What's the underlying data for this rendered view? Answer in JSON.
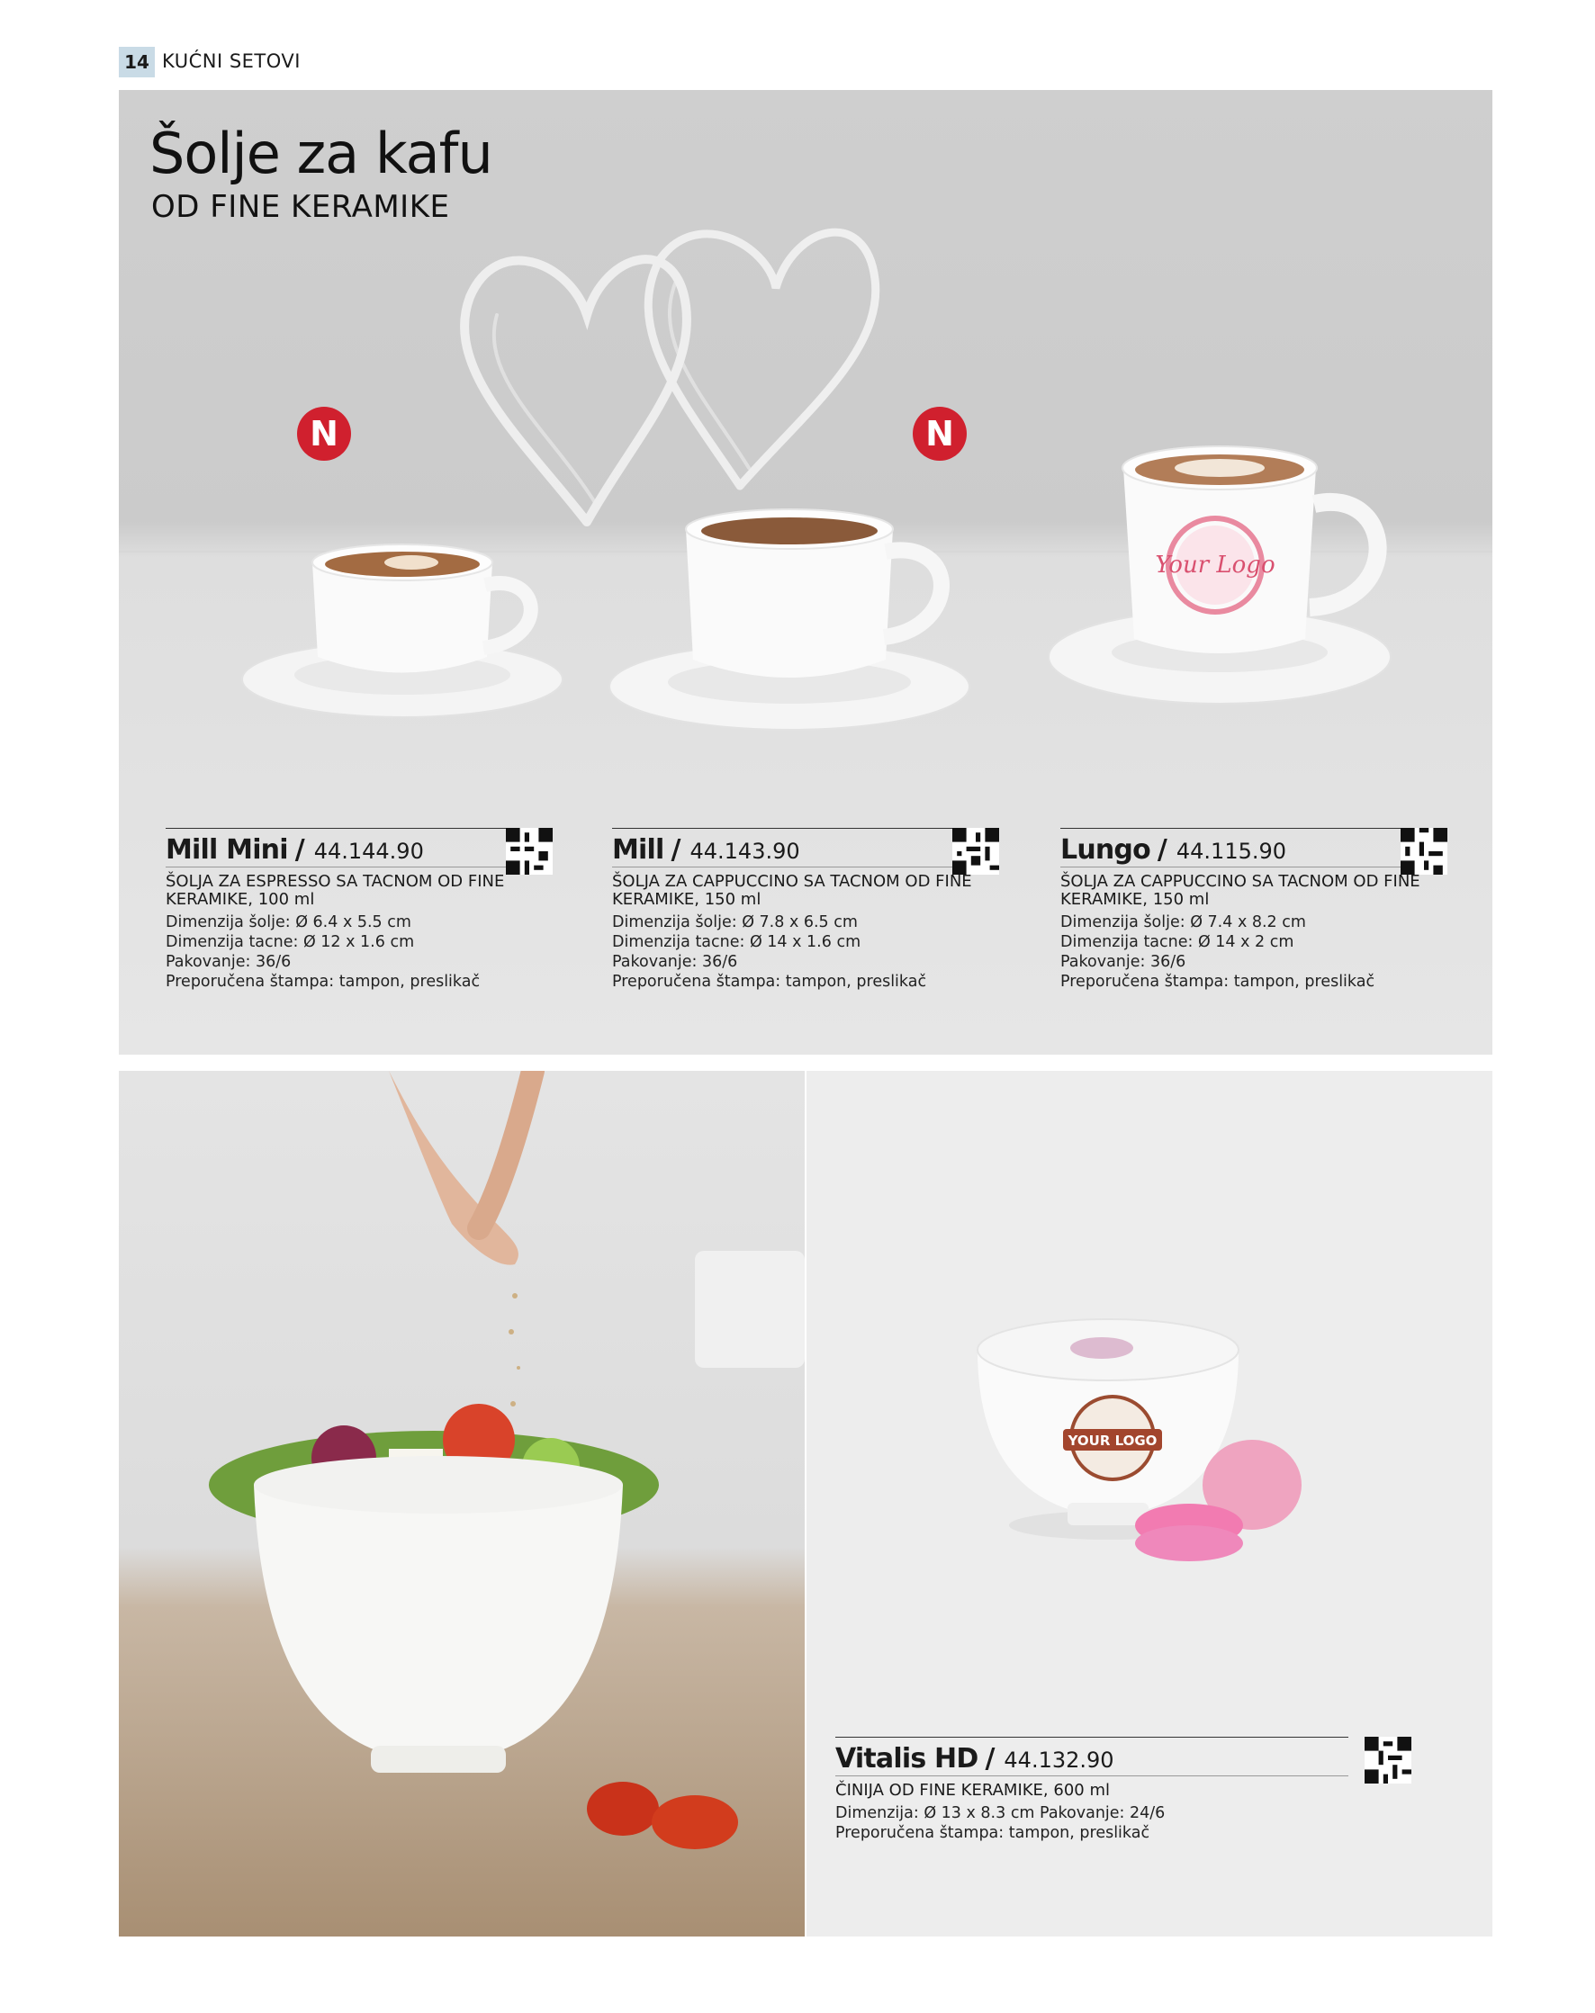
{
  "header": {
    "page_number": "14",
    "section": "KUĆNI SETOVI"
  },
  "hero": {
    "title": "Šolje za kafu",
    "subtitle": "OD FINE KERAMIKE"
  },
  "badge_letter": "N",
  "products": [
    {
      "name": "Mill Mini",
      "code": "44.144.90",
      "is_new": true,
      "desc": "ŠOLJA ZA ESPRESSO SA TACNOM OD FINE KERAMIKE, 100 ml",
      "specs": [
        "Dimenzija šolje: Ø 6.4 x 5.5 cm",
        "Dimenzija tacne: Ø 12 x 1.6 cm",
        "Pakovanje: 36/6",
        "Preporučena štampa: tampon, preslikač"
      ]
    },
    {
      "name": "Mill",
      "code": "44.143.90",
      "is_new": true,
      "desc": "ŠOLJA ZA CAPPUCCINO SA TACNOM OD FINE KERAMIKE, 150 ml",
      "specs": [
        "Dimenzija šolje: Ø 7.8 x 6.5 cm",
        "Dimenzija tacne: Ø 14 x 1.6 cm",
        "Pakovanje: 36/6",
        "Preporučena štampa: tampon, preslikač"
      ]
    },
    {
      "name": "Lungo",
      "code": "44.115.90",
      "is_new": false,
      "desc": "ŠOLJA ZA CAPPUCCINO SA TACNOM OD FINE KERAMIKE, 150 ml",
      "specs": [
        "Dimenzija šolje: Ø 7.4 x 8.2 cm",
        "Dimenzija tacne: Ø 14 x 2 cm",
        "Pakovanje: 36/6",
        "Preporučena štampa: tampon, preslikač"
      ]
    },
    {
      "name": "Vitalis HD",
      "code": "44.132.90",
      "is_new": false,
      "desc": "ČINIJA OD FINE KERAMIKE, 600 ml",
      "specs": [
        "Dimenzija: Ø 13 x 8.3 cm Pakovanje: 24/6",
        "Preporučena štampa: tampon, preslikač"
      ]
    }
  ],
  "mockup_logos": {
    "cup_logo": "Your Logo",
    "bowl_logo": "YOUR LOGO"
  },
  "colors": {
    "badge_red": "#d0202e",
    "page_tab": "#c9dbe6",
    "panel_gray": "#d2d2d2"
  }
}
